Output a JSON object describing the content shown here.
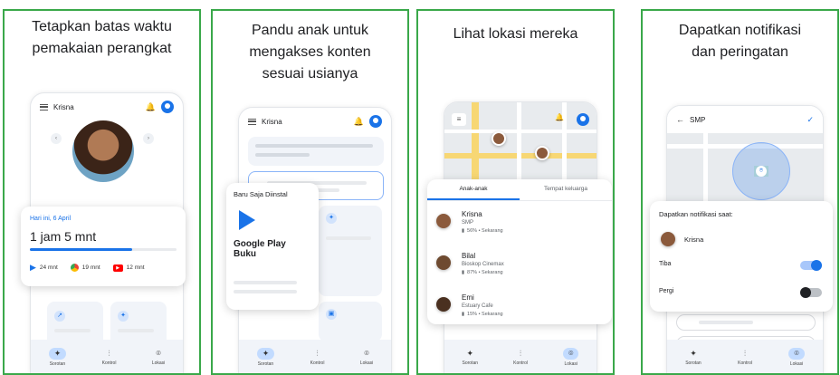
{
  "panel1": {
    "caption_line1": "Tetapkan batas waktu",
    "caption_line2": "pemakaian perangkat",
    "child_name": "Krisna",
    "date": "Hari ini, 6 April",
    "total_time": "1 jam 5 mnt",
    "apps": [
      {
        "icon": "play-store-icon",
        "time": "24 mnt"
      },
      {
        "icon": "chrome-icon",
        "time": "19 mnt"
      },
      {
        "icon": "youtube-icon",
        "time": "12 mnt"
      }
    ],
    "nav": [
      "Sorotan",
      "Kontrol",
      "Lokasi"
    ]
  },
  "panel2": {
    "caption_line1": "Pandu anak untuk",
    "caption_line2": "mengakses konten",
    "caption_line3": "sesuai usianya",
    "child_name": "Krisna",
    "popup_title": "Baru Saja Diinstal",
    "app_name_line1": "Google Play",
    "app_name_line2": "Buku",
    "nav": [
      "Sorotan",
      "Kontrol",
      "Lokasi"
    ]
  },
  "panel3": {
    "caption": "Lihat lokasi mereka",
    "tabs": [
      "Anak-anak",
      "Tempat keluarga"
    ],
    "children": [
      {
        "name": "Krisna",
        "place": "SMP",
        "status": "56% • Sekarang"
      },
      {
        "name": "Bilal",
        "place": "Bioskop Cinemax",
        "status": "87% • Sekarang"
      },
      {
        "name": "Emi",
        "place": "Estuary Cafe",
        "status": "15% • Sekarang"
      }
    ],
    "nav": [
      "Sorotan",
      "Kontrol",
      "Lokasi"
    ]
  },
  "panel4": {
    "caption_line1": "Dapatkan notifikasi",
    "caption_line2": "dan peringatan",
    "place_title": "SMP",
    "card_title": "Dapatkan notifikasi saat:",
    "child_name": "Krisna",
    "options": [
      {
        "label": "Tiba",
        "on": true
      },
      {
        "label": "Pergi",
        "on": false
      }
    ],
    "nav": [
      "Sorotan",
      "Kontrol",
      "Lokasi"
    ]
  },
  "colors": {
    "border": "#3aa84a",
    "accent": "#1a73e8",
    "text": "#202124"
  }
}
